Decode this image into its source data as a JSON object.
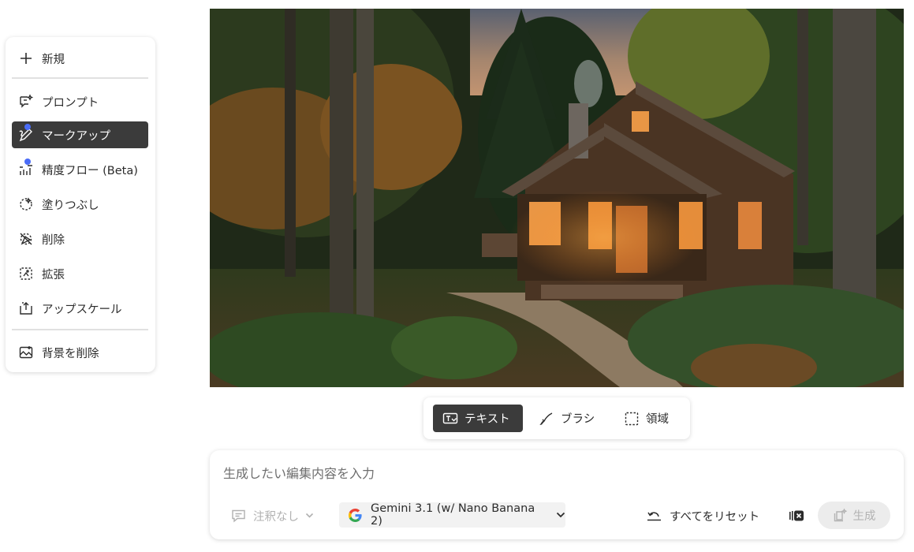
{
  "menu": {
    "new_label": "新規",
    "items": [
      {
        "label": "プロンプト",
        "icon": "prompt-icon"
      },
      {
        "label": "マークアップ",
        "icon": "markup-icon",
        "active": true,
        "badge": true
      },
      {
        "label": "精度フロー (Beta)",
        "icon": "precision-flow-icon",
        "badge": true
      },
      {
        "label": "塗りつぶし",
        "icon": "fill-icon"
      },
      {
        "label": "削除",
        "icon": "remove-icon"
      },
      {
        "label": "拡張",
        "icon": "expand-icon"
      },
      {
        "label": "アップスケール",
        "icon": "upscale-icon"
      }
    ],
    "remove_bg_label": "背景を削除"
  },
  "modes": {
    "text_label": "テキスト",
    "brush_label": "ブラシ",
    "area_label": "領域",
    "active": "text"
  },
  "prompt": {
    "placeholder": "生成したい編集内容を入力",
    "annotation_label": "注釈なし",
    "model_label": "Gemini 3.1 (w/ Nano Banana 2)",
    "reset_label": "すべてをリセット",
    "generate_label": "生成"
  },
  "colors": {
    "active_bg": "#3b3b3b",
    "badge": "#4a6cf7",
    "disabled_bg": "#ececec"
  }
}
